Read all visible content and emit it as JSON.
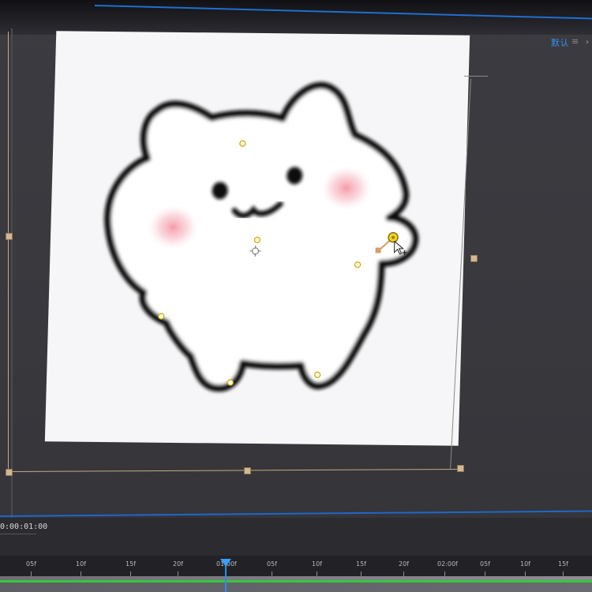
{
  "header": {
    "workspace_label": "默认",
    "workspace_separator": "≡",
    "menu_icon": "chevron-right-icon"
  },
  "timeline": {
    "timecode": "0:00:01:00",
    "ruler_labels": [
      "05f",
      "10f",
      "15f",
      "20f",
      "01:00f",
      "05f",
      "10f",
      "15f",
      "20f",
      "02:00f",
      "05f",
      "10f",
      "15f"
    ],
    "playhead_label": "01:00f"
  },
  "colors": {
    "accent": "#1f6fd1",
    "handle": "#d2b794",
    "keyframe": "#e3c300",
    "work_area_green": "#33c93a"
  },
  "icons": {
    "anchor_point": "anchor-point-icon",
    "selection_cursor": "move-cursor-icon",
    "puppet_pin": "puppet-pin-icon"
  }
}
